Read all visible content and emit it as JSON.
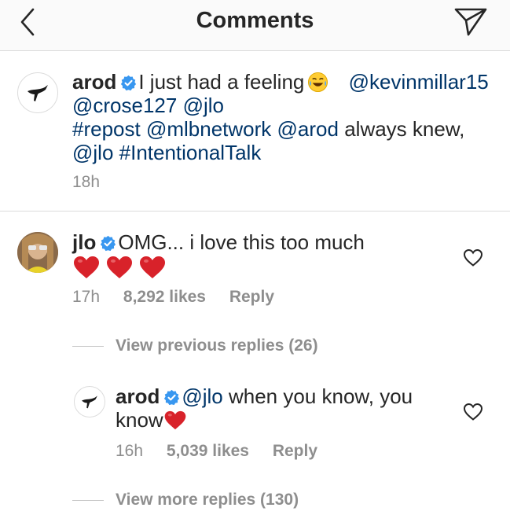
{
  "header": {
    "title": "Comments",
    "back_icon": "chevron-left-icon",
    "send_icon": "paper-plane-icon"
  },
  "caption": {
    "username": "arod",
    "text_1": "I just had a feeling",
    "emoji": "😂",
    "mention_1": "@kevinmillar15",
    "mention_2": "@crose127",
    "mention_3": "@jlo",
    "hashtag_1": "#repost",
    "mention_4": "@mlbnetwork",
    "mention_5": "@arod",
    "text_2": "always knew,",
    "mention_6": "@jlo",
    "hashtag_2": "#IntentionalTalk",
    "time": "18h"
  },
  "comment": {
    "username": "jlo",
    "text": "OMG... i love this too much",
    "hearts": [
      "❤️",
      "❤️",
      "❤️"
    ],
    "time": "17h",
    "likes": "8,292 likes",
    "reply_label": "Reply"
  },
  "view_previous": "View previous replies (26)",
  "reply": {
    "username": "arod",
    "mention": "@jlo",
    "text_1": "when you know, you",
    "text_2": "know",
    "time": "16h",
    "likes": "5,039 likes",
    "reply_label": "Reply"
  },
  "view_more": "View more replies (130)",
  "colors": {
    "text": "#262626",
    "secondary": "#8e8e8e",
    "link": "#003569",
    "verified": "#3897f0",
    "heart": "#ed4956",
    "divider": "#dbdbdb"
  }
}
